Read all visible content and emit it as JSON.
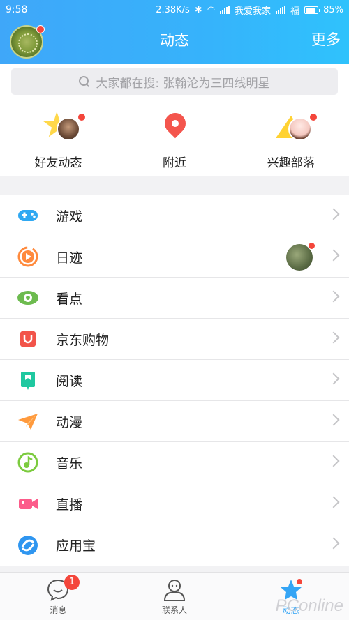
{
  "status_bar": {
    "time": "9:58",
    "speed": "2.38K/s",
    "carrier": "我爱我家",
    "extra": "福",
    "battery": "85%"
  },
  "header": {
    "title": "动态",
    "more_label": "更多"
  },
  "search": {
    "placeholder": "大家都在搜: 张翰沦为三四线明星"
  },
  "shortcuts": [
    {
      "label": "好友动态",
      "icon": "friends-star-icon"
    },
    {
      "label": "附近",
      "icon": "location-pin-icon"
    },
    {
      "label": "兴趣部落",
      "icon": "tribe-tent-icon"
    }
  ],
  "menu": [
    {
      "label": "游戏",
      "icon": "gamepad-icon",
      "color": "#2fa8f2"
    },
    {
      "label": "日迹",
      "icon": "play-circle-icon",
      "color": "#ff8a3d"
    },
    {
      "label": "看点",
      "icon": "eye-icon",
      "color": "#6dbb4f"
    },
    {
      "label": "京东购物",
      "icon": "shopping-bag-icon",
      "color": "#f2544a"
    },
    {
      "label": "阅读",
      "icon": "bookmark-icon",
      "color": "#1fc8a0"
    },
    {
      "label": "动漫",
      "icon": "paper-plane-icon",
      "color": "#ff9a3d"
    },
    {
      "label": "音乐",
      "icon": "music-note-icon",
      "color": "#7ccb3f"
    },
    {
      "label": "直播",
      "icon": "video-camera-icon",
      "color": "#fc5b8a"
    },
    {
      "label": "应用宝",
      "icon": "app-store-icon",
      "color": "#2f96f0"
    }
  ],
  "tabbar": {
    "messages_label": "消息",
    "messages_badge": "1",
    "contacts_label": "联系人",
    "feed_label": "动态",
    "watermark": "PConline"
  },
  "colors": {
    "header_start": "#3fa7f9",
    "header_end": "#2fc2fc",
    "badge": "#f4463b",
    "active_tab": "#35a5f5"
  }
}
